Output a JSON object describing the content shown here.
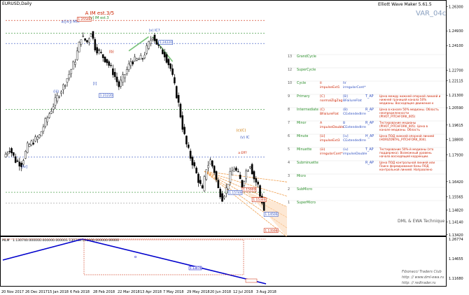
{
  "window": {
    "title": "EURUSD,Daily",
    "indicator_name": "Elliott Wave Maker 5.61.5",
    "var_label": "VAR_04c"
  },
  "chart_data": {
    "type": "candlestick",
    "symbol": "EURUSD",
    "timeframe": "Daily",
    "ylim": [
      1.1365,
      1.262
    ],
    "price_ticks": [
      "1.26300",
      "1.24930",
      "1.24100",
      "1.22700",
      "1.22115",
      "1.21300",
      "1.20590",
      "1.19615",
      "1.18800",
      "1.17930",
      "1.16420",
      "1.15565",
      "1.14820",
      "1.14140",
      "1.13420",
      "1.12565",
      "1.11890"
    ],
    "time_labels": [
      "20 Nov 2017",
      "26 Dec 2017",
      "15 Jan 2018",
      "6 Feb 2018",
      "28 Feb 2018",
      "22 Mar 2018",
      "13 Apr 2018",
      "7 May 2018",
      "29 May 2018",
      "20 Jun 2018",
      "12 Jul 2018",
      "3 Aug 2018"
    ],
    "close_path": [
      [
        0,
        1.178
      ],
      [
        3,
        1.183
      ],
      [
        6,
        1.176
      ],
      [
        9,
        1.174
      ],
      [
        12,
        1.184
      ],
      [
        15,
        1.187
      ],
      [
        18,
        1.19
      ],
      [
        21,
        1.198
      ],
      [
        24,
        1.205
      ],
      [
        27,
        1.212
      ],
      [
        30,
        1.218
      ],
      [
        33,
        1.225
      ],
      [
        36,
        1.233
      ],
      [
        39,
        1.246
      ],
      [
        42,
        1.243
      ],
      [
        44,
        1.249
      ],
      [
        46,
        1.24
      ],
      [
        49,
        1.236
      ],
      [
        52,
        1.232
      ],
      [
        55,
        1.226
      ],
      [
        58,
        1.218
      ],
      [
        61,
        1.225
      ],
      [
        64,
        1.232
      ],
      [
        67,
        1.233
      ],
      [
        70,
        1.234
      ],
      [
        73,
        1.242
      ],
      [
        75,
        1.247
      ],
      [
        78,
        1.24
      ],
      [
        81,
        1.236
      ],
      [
        84,
        1.228
      ],
      [
        86,
        1.218
      ],
      [
        88,
        1.208
      ],
      [
        90,
        1.195
      ],
      [
        92,
        1.185
      ],
      [
        94,
        1.178
      ],
      [
        96,
        1.172
      ],
      [
        98,
        1.165
      ],
      [
        100,
        1.159
      ],
      [
        102,
        1.172
      ],
      [
        104,
        1.176
      ],
      [
        106,
        1.17
      ],
      [
        108,
        1.16
      ],
      [
        110,
        1.155
      ],
      [
        112,
        1.16
      ],
      [
        114,
        1.168
      ],
      [
        116,
        1.172
      ],
      [
        118,
        1.168
      ],
      [
        120,
        1.162
      ],
      [
        122,
        1.17
      ],
      [
        124,
        1.174
      ],
      [
        126,
        1.166
      ],
      [
        128,
        1.162
      ],
      [
        129,
        1.156
      ],
      [
        130,
        1.153
      ],
      [
        131,
        1.148
      ]
    ],
    "wave_labels": [
      "A IM est.3/5",
      "[v] IM est.3",
      "a([iv]) MIX",
      "(c)(C)",
      "[iv]",
      "(iii)",
      "[i]",
      "(v) IC",
      "(v) IC?",
      "a Eff?",
      "(b)"
    ],
    "price_boxes": [
      "1.25546",
      "1.24220",
      "1.21220",
      "1.15909",
      "1.15749",
      "1.15340",
      "1.13598",
      "1.14506"
    ],
    "indicator": {
      "name": "MLM",
      "values": [
        "1.13074",
        "0.00000",
        "0.00000",
        "0.00000",
        "1.13074",
        "0.00000",
        "0.00000",
        "0.00000"
      ],
      "box_label": "1.13074",
      "marker": "o",
      "ylim": [
        0,
        1
      ],
      "y_ticks": [
        "1.26774",
        "1.14655",
        "1.11680"
      ]
    }
  },
  "wave_table": {
    "rows": [
      {
        "num": "13",
        "name": "GrandCycle",
        "c1": "",
        "c2": "",
        "c3": "",
        "desc": ""
      },
      {
        "num": "12",
        "name": "SuperCycle",
        "c1": "",
        "c2": "",
        "c3": "",
        "desc": ""
      },
      {
        "num": "10",
        "name": "Cycle",
        "c1": "II impulseExt1",
        "c2": "IV irregularCont*",
        "c3": "",
        "desc": ""
      },
      {
        "num": "9",
        "name": "Primary",
        "c1": "[C] normalZigZag",
        "c2": "[B] BFailureFlat",
        "c3": "T_AP",
        "desc": "Цена между нижней опорной линией и нижней границей канала 50% медианы. Восходящее движение к"
      },
      {
        "num": "8",
        "name": "Intermediate",
        "c1": "(C) BFailureFlat",
        "c2": "(B) CExtendedIrre",
        "c3": "R_AP",
        "desc": "Цена в канале 50% медианы. Область неопределенности (PIVOT_PITCHFORK_005)"
      },
      {
        "num": "7",
        "name": "Minor",
        "c1": "A impulseDouble",
        "c2": "B CExtendedIrre",
        "c3": "R_AP",
        "desc": "Тестирование медианы (PIVOT_PITCHFORK_005). Цена в канале медианы. Область"
      },
      {
        "num": "6",
        "name": "Minute",
        "c1": "[iii] impulseExt3",
        "c2": "[iv] CExtendedIrre",
        "c3": "H_AP",
        "desc": "Цена ПОД нижней опорной линией (HORIZONTAL_PITCHFORK_004)."
      },
      {
        "num": "5",
        "name": "Minuette",
        "c1": "(iii) irregularCont*",
        "c2": "(iv) impulseDouble",
        "c3": "T_AP",
        "desc": "Тестирование 50%-й медианы (это поддержка). Возможный уровень начала восходящей коррекции."
      },
      {
        "num": "4",
        "name": "Subminuette",
        "c1": "",
        "c2": "",
        "c3": "R_AP",
        "desc": "Цена ПОД контрольной линией или Поиск формирования базы ПОД контрольной линией. Направлено"
      },
      {
        "num": "3",
        "name": "Micro",
        "c1": "",
        "c2": "",
        "c3": "",
        "desc": ""
      },
      {
        "num": "2",
        "name": "SubMicro",
        "c1": "",
        "c2": "",
        "c3": "",
        "desc": ""
      },
      {
        "num": "1",
        "name": "SuperMicro",
        "c1": "",
        "c2": "",
        "c3": "",
        "desc": ""
      }
    ]
  },
  "footer": {
    "brand": "DML & EWA Technique",
    "line2": "Fibonacci   Traders   Club",
    "url1": "http: // www.dml-ewa.ru",
    "url2": "http: // redtrader.ru"
  },
  "colors": {
    "bull": "#000000",
    "bear": "#000000",
    "accent_blue": "#0000cc",
    "accent_red": "#cc2200",
    "accent_green": "#2b8f2b",
    "fan_orange": "#f0a050",
    "grid": "#c8c8c8"
  }
}
